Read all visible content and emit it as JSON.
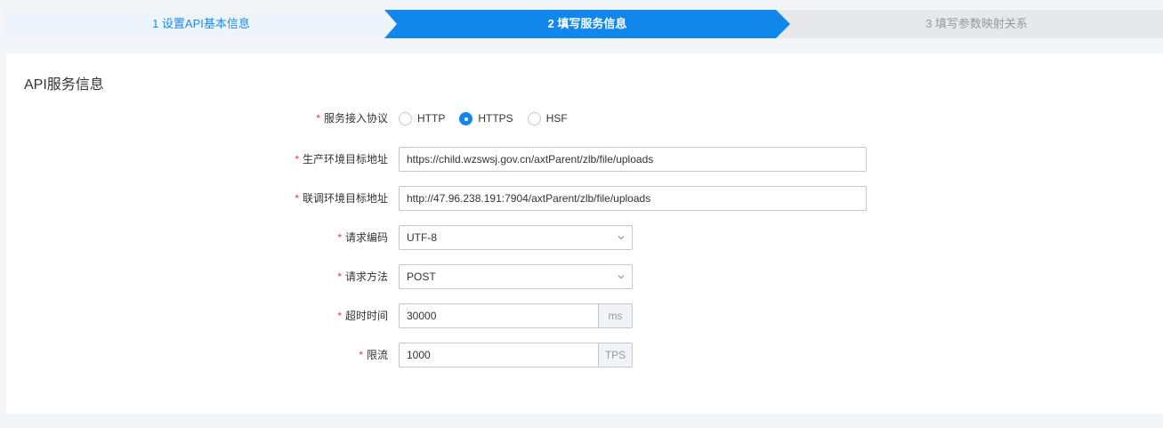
{
  "steps": {
    "step1": "1 设置API基本信息",
    "step2": "2 填写服务信息",
    "step3": "3 填写参数映射关系"
  },
  "section_title": "API服务信息",
  "required_mark": "*",
  "form": {
    "protocol": {
      "label": "服务接入协议",
      "options": [
        "HTTP",
        "HTTPS",
        "HSF"
      ],
      "selected": "HTTPS"
    },
    "prod_url": {
      "label": "生产环境目标地址",
      "value": "https://child.wzswsj.gov.cn/axtParent/zlb/file/uploads"
    },
    "debug_url": {
      "label": "联调环境目标地址",
      "value": "http://47.96.238.191:7904/axtParent/zlb/file/uploads"
    },
    "encoding": {
      "label": "请求编码",
      "value": "UTF-8"
    },
    "method": {
      "label": "请求方法",
      "value": "POST"
    },
    "timeout": {
      "label": "超时时间",
      "value": "30000",
      "unit": "ms"
    },
    "rate_limit": {
      "label": "限流",
      "value": "1000",
      "unit": "TPS"
    }
  },
  "colors": {
    "accent": "#1187ec",
    "required": "#f04134"
  },
  "icons": {
    "select_arrow": "chevron-down-icon"
  }
}
